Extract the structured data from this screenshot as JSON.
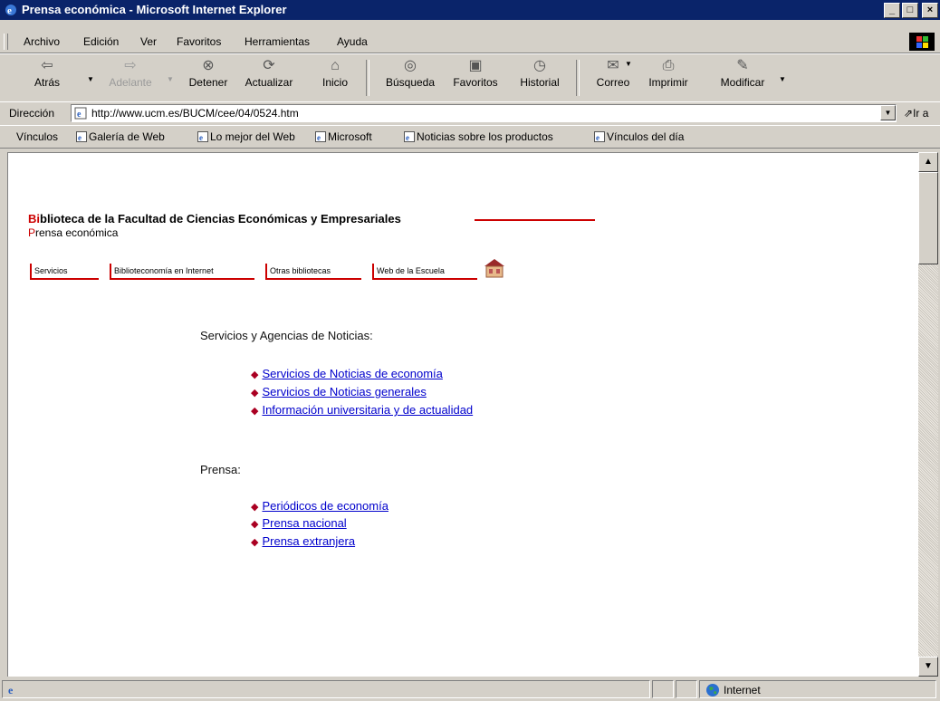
{
  "window": {
    "title": "Prensa económica - Microsoft Internet Explorer",
    "controls": {
      "minimize": "_",
      "maximize": "□",
      "close": "×"
    }
  },
  "menu": {
    "items": [
      "Archivo",
      "Edición",
      "Ver",
      "Favoritos",
      "Herramientas",
      "Ayuda"
    ]
  },
  "toolbar": {
    "buttons": [
      {
        "label": "Atrás",
        "icon": "back-arrow-icon"
      },
      {
        "label": "Adelante",
        "icon": "forward-arrow-icon"
      },
      {
        "label": "Detener",
        "icon": "stop-icon"
      },
      {
        "label": "Actualizar",
        "icon": "refresh-icon"
      },
      {
        "label": "Inicio",
        "icon": "home-icon"
      },
      {
        "label": "Búsqueda",
        "icon": "search-icon"
      },
      {
        "label": "Favoritos",
        "icon": "favorites-icon"
      },
      {
        "label": "Historial",
        "icon": "history-icon"
      },
      {
        "label": "Correo",
        "icon": "mail-icon"
      },
      {
        "label": "Imprimir",
        "icon": "print-icon"
      },
      {
        "label": "Modificar",
        "icon": "edit-icon"
      }
    ]
  },
  "address": {
    "label": "Dirección",
    "url": "http://www.ucm.es/BUCM/cee/04/0524.htm",
    "go_label": "Ir a"
  },
  "links": {
    "label": "Vínculos",
    "items": [
      "Galería de Web",
      "Lo mejor del Web",
      "Microsoft",
      "Noticias sobre los productos",
      "Vínculos del día"
    ]
  },
  "page": {
    "heading_initial": "Bi",
    "heading_rest": "blioteca de la Facultad de Ciencias Económicas y Empresariales",
    "subtitle_initial": "P",
    "subtitle_rest": "rensa económica",
    "nav": [
      "Servicios",
      "Biblioteconomía en Internet",
      "Otras bibliotecas",
      "Web de la Escuela"
    ],
    "section1": {
      "title": "Servicios y Agencias de Noticias:",
      "links": [
        "Servicios de Noticias de economía",
        "Servicios de Noticias generales",
        "Información universitaria y de actualidad"
      ]
    },
    "section2": {
      "title": "Prensa:",
      "links": [
        "Periódicos de economía",
        "Prensa nacional",
        "Prensa extranjera"
      ]
    }
  },
  "status": {
    "zone": "Internet"
  },
  "colors": {
    "titlebar": "#0a246a",
    "accent_red": "#cc0000",
    "link_blue": "#0000cc",
    "chrome": "#d4d0c8"
  }
}
